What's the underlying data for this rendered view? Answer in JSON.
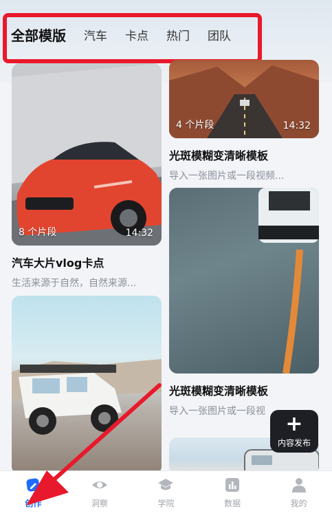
{
  "tabs": [
    {
      "label": "全部模版",
      "active": true
    },
    {
      "label": "汽车"
    },
    {
      "label": "卡点"
    },
    {
      "label": "热门"
    },
    {
      "label": "团队"
    }
  ],
  "cards": {
    "car": {
      "segments": "8 个片段",
      "duration": "14:32",
      "title": "汽车大片vlog卡点",
      "desc": "生活来源于自然，自然来源..."
    },
    "road": {
      "segments": "4 个片段",
      "duration": "14:32",
      "title": "光斑模糊变清晰模板",
      "desc": "导入一张图片或一段视频..."
    },
    "blur": {
      "title": "光斑模糊变清晰模板",
      "desc": "导入一张图片或一段视"
    }
  },
  "publish": {
    "label": "内容发布"
  },
  "nav": [
    {
      "label": "创作",
      "icon": "create-icon",
      "active": true
    },
    {
      "label": "洞察",
      "icon": "eye-icon"
    },
    {
      "label": "学院",
      "icon": "graduation-cap-icon"
    },
    {
      "label": "数据",
      "icon": "bar-chart-icon"
    },
    {
      "label": "我的",
      "icon": "user-icon"
    }
  ],
  "colors": {
    "accent": "#1e6bff",
    "highlight": "#e8192c",
    "arrow": "#e8192c"
  }
}
